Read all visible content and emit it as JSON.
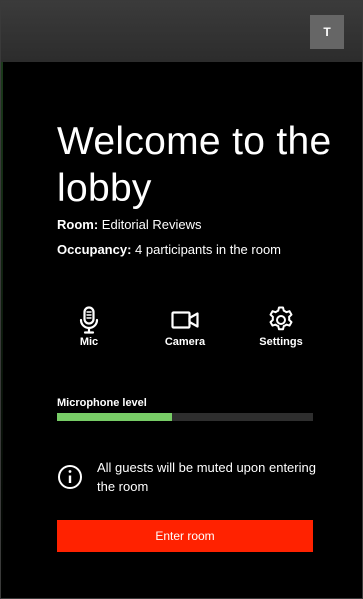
{
  "header": {
    "avatar_initial": "T"
  },
  "lobby": {
    "title": "Welcome to the lobby",
    "room_label": "Room:",
    "room_value": "Editorial Reviews",
    "occupancy_label": "Occupancy:",
    "occupancy_value": "4 participants in the room"
  },
  "controls": {
    "mic_label": "Mic",
    "camera_label": "Camera",
    "settings_label": "Settings"
  },
  "microphone": {
    "label": "Microphone level",
    "level_percent": 45
  },
  "notice": {
    "text": "All guests will be muted upon entering the room"
  },
  "enter_button": {
    "label": "Enter room"
  },
  "colors": {
    "background": "#000000",
    "accent": "#ff2200",
    "meter_fill": "#77cc66",
    "meter_track": "#2e2e2e",
    "avatar_bg": "#666666"
  },
  "icons": [
    "microphone-icon",
    "camera-icon",
    "gear-icon",
    "info-icon"
  ]
}
